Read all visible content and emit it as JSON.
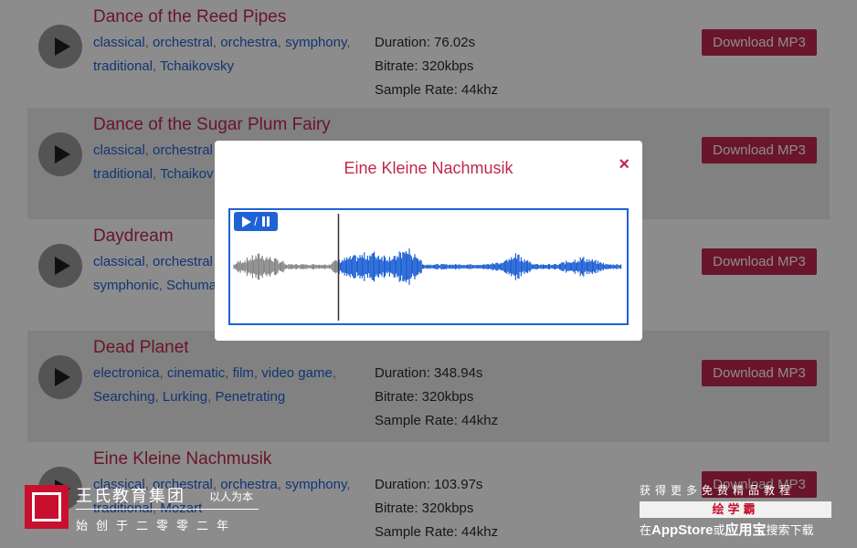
{
  "tracks": [
    {
      "title": "Dance of the Reed Pipes",
      "tags": [
        "classical",
        "orchestral",
        "orchestra",
        "symphony",
        "traditional",
        "Tchaikovsky"
      ],
      "duration": "Duration: 76.02s",
      "bitrate": "Bitrate: 320kbps",
      "sample_rate": "Sample Rate: 44khz"
    },
    {
      "title": "Dance of the Sugar Plum Fairy",
      "tags": [
        "classical",
        "orchestral",
        "traditional",
        "Tchaikov"
      ],
      "duration": "",
      "bitrate": "",
      "sample_rate": ""
    },
    {
      "title": "Daydream",
      "tags": [
        "classical",
        "orchestral",
        "symphonic",
        "Schuma"
      ],
      "duration": "",
      "bitrate": "",
      "sample_rate": ""
    },
    {
      "title": "Dead Planet",
      "tags": [
        "electronica",
        "cinematic",
        "film",
        "video game",
        "Searching",
        "Lurking",
        "Penetrating"
      ],
      "duration": "Duration: 348.94s",
      "bitrate": "Bitrate: 320kbps",
      "sample_rate": "Sample Rate: 44khz"
    },
    {
      "title": "Eine Kleine Nachmusik",
      "tags": [
        "classical",
        "orchestral",
        "orchestra",
        "symphony",
        "traditional",
        "Mozart"
      ],
      "duration": "Duration: 103.97s",
      "bitrate": "Bitrate: 320kbps",
      "sample_rate": "Sample Rate: 44khz"
    }
  ],
  "download_label": "Download MP3",
  "modal": {
    "title": "Eine Kleine Nachmusik",
    "close_glyph": "×",
    "playpause_slash": "/",
    "playhead_fraction": 0.27
  },
  "watermark": {
    "org_name": "王氏教育集团",
    "motto": "以人为本",
    "since": "始创于二零零二年",
    "promo_top": "获得更多免费精品教程",
    "promo_brand": "绘学霸",
    "promo_bottom_prefix": "在",
    "promo_appstore": "AppStore",
    "promo_or": "或",
    "promo_yyb": "应用宝",
    "promo_bottom_suffix": "搜索下载"
  },
  "colors": {
    "accent": "#c2274d",
    "link": "#1f62d4",
    "played_wave": "#888888",
    "unplayed_wave": "#1f62d4"
  }
}
